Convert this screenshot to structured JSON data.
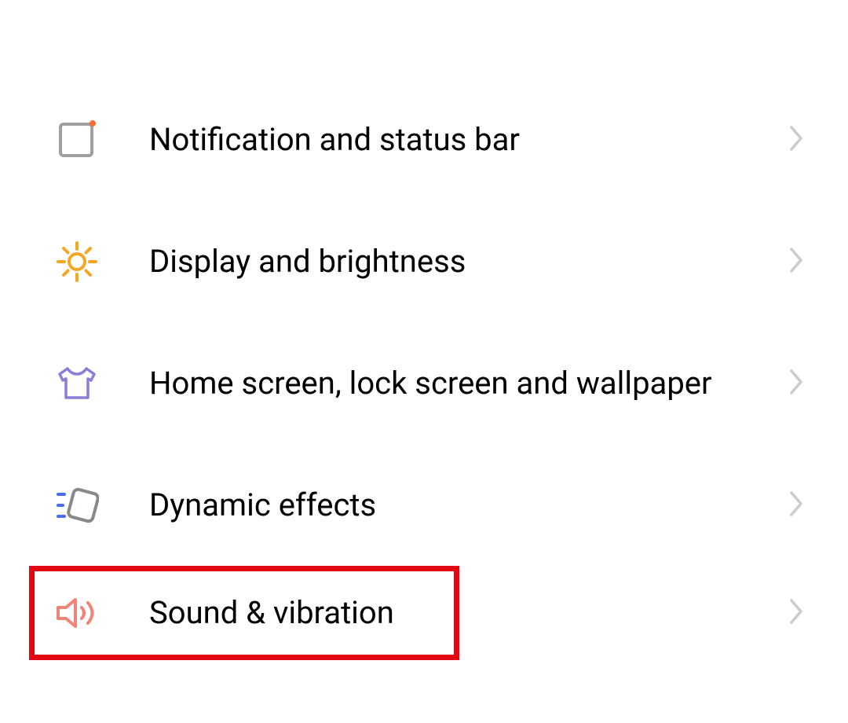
{
  "settings": {
    "items": [
      {
        "id": "notification",
        "label": "Notification and status bar",
        "icon": "notification-icon"
      },
      {
        "id": "display",
        "label": "Display and brightness",
        "icon": "brightness-icon"
      },
      {
        "id": "homescreen",
        "label": "Home screen, lock screen and wallpaper",
        "icon": "tshirt-icon"
      },
      {
        "id": "dynamic",
        "label": "Dynamic effects",
        "icon": "dynamic-icon"
      },
      {
        "id": "sound",
        "label": "Sound & vibration",
        "icon": "sound-icon"
      }
    ]
  }
}
